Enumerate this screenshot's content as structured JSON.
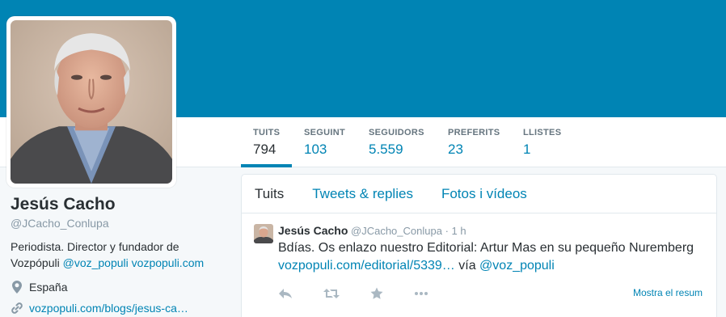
{
  "profile": {
    "name": "Jesús Cacho",
    "handle": "@JCacho_Conlupa",
    "bio_text": "Periodista. Director y fundador de Vozpópuli",
    "bio_mention": "@voz_populi",
    "bio_link": "vozpopuli.com",
    "location": "España",
    "website": "vozpopuli.com/blogs/jesus-ca…"
  },
  "stats": [
    {
      "label": "TUITS",
      "value": "794"
    },
    {
      "label": "SEGUINT",
      "value": "103"
    },
    {
      "label": "SEGUIDORS",
      "value": "5.559"
    },
    {
      "label": "PREFERITS",
      "value": "23"
    },
    {
      "label": "LLISTES",
      "value": "1"
    }
  ],
  "tabs": [
    {
      "label": "Tuits"
    },
    {
      "label": "Tweets & replies"
    },
    {
      "label": "Fotos i vídeos"
    }
  ],
  "tweet": {
    "name": "Jesús Cacho",
    "handle": "@JCacho_Conlupa",
    "separator": "·",
    "time": "1 h",
    "text": "Bdías. Os enlazo nuestro Editorial: Artur Mas en su pequeño Nuremberg",
    "link": "vozpopuli.com/editorial/5339…",
    "via": "vía",
    "via_mention": "@voz_populi",
    "summary": "Mostra el resum"
  },
  "colors": {
    "banner": "#0084b4",
    "link": "#0084b4",
    "text": "#292f33",
    "muted": "#8899a6"
  },
  "icons": [
    "location-pin-icon",
    "link-icon",
    "reply-icon",
    "retweet-icon",
    "favorite-star-icon"
  ]
}
